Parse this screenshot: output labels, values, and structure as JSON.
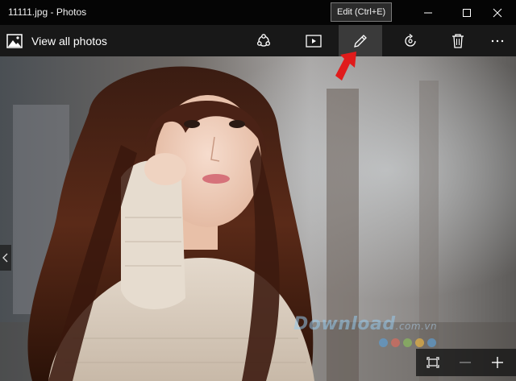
{
  "window": {
    "title": "11111.jpg - Photos",
    "minimize_icon": "minimize-icon",
    "maximize_icon": "maximize-icon",
    "close_icon": "close-icon"
  },
  "toolbar": {
    "view_all_label": "View all photos",
    "buttons": [
      {
        "name": "share",
        "icon": "share-icon"
      },
      {
        "name": "slideshow",
        "icon": "slideshow-icon"
      },
      {
        "name": "edit",
        "icon": "pencil-icon",
        "active": true
      },
      {
        "name": "rotate",
        "icon": "rotate-icon"
      },
      {
        "name": "delete",
        "icon": "trash-icon"
      },
      {
        "name": "more",
        "icon": "more-icon"
      }
    ],
    "tooltip": "Edit (Ctrl+E)"
  },
  "viewer": {
    "prev_icon": "chevron-left-icon",
    "zoom_controls": [
      "fit-icon",
      "minus-icon",
      "plus-icon"
    ]
  },
  "watermark": {
    "text": "Download",
    "suffix": ".com.vn"
  },
  "colors": {
    "titlebar": "#050505",
    "toolbar": "#1a1a1a",
    "active_button": "#3a3a3a",
    "arrow": "#e01b1b"
  }
}
